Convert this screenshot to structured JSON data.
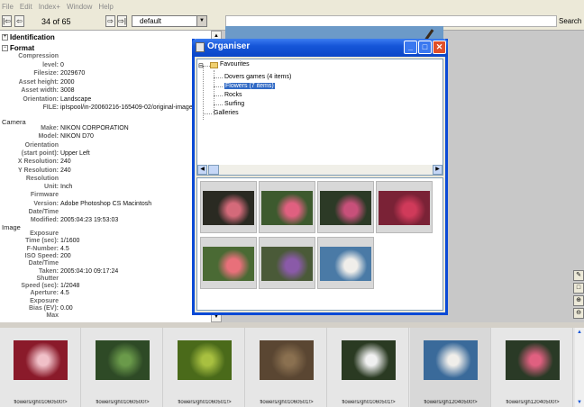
{
  "menu": [
    "File",
    "Edit",
    "Index+",
    "Window",
    "Help"
  ],
  "toolbar": {
    "first_icon": "first-icon",
    "prev_icon": "prev-icon",
    "counter": "34 of 65",
    "next_icon": "next-icon",
    "last_icon": "last-icon",
    "profile": "default",
    "search_label": "Search"
  },
  "info": {
    "identification_title": "Identification",
    "format_title": "Format",
    "format_rows": [
      {
        "label": "Compression",
        "value": ""
      },
      {
        "label": "level:",
        "value": "0"
      },
      {
        "label": "Filesize:",
        "value": "2029670"
      },
      {
        "label": "Asset height:",
        "value": "2000"
      },
      {
        "label": "Asset width:",
        "value": "3008"
      },
      {
        "label": "Orientation:",
        "value": "Landscape"
      },
      {
        "label": "FILE:",
        "value": "ipIspool/in-20060216-165409-02/original-image"
      }
    ],
    "camera_title": "Camera",
    "camera_rows": [
      {
        "label": "Make:",
        "value": "NIKON CORPORATION"
      },
      {
        "label": "Model:",
        "value": "NIKON D70"
      },
      {
        "label": "Orientation",
        "value": ""
      },
      {
        "label": "(start point):",
        "value": "Upper Left"
      },
      {
        "label": "X Resolution:",
        "value": "240"
      },
      {
        "label": "Y Resolution:",
        "value": "240"
      },
      {
        "label": "Resolution",
        "value": ""
      },
      {
        "label": "Unit:",
        "value": "Inch"
      },
      {
        "label": "Firmware",
        "value": ""
      },
      {
        "label": "Version:",
        "value": "Adobe Photoshop CS Macintosh"
      },
      {
        "label": "Date/Time",
        "value": ""
      },
      {
        "label": "Modified:",
        "value": "2005:04:23 19:53:03"
      }
    ],
    "image_title": "Image",
    "image_rows": [
      {
        "label": "Exposure",
        "value": ""
      },
      {
        "label": "Time (sec):",
        "value": "1/1600"
      },
      {
        "label": "F-Number:",
        "value": "4.5"
      },
      {
        "label": "ISO Speed:",
        "value": "200"
      },
      {
        "label": "Date/Time",
        "value": ""
      },
      {
        "label": "Taken:",
        "value": "2005:04:10 09:17:24"
      },
      {
        "label": "Shutter",
        "value": ""
      },
      {
        "label": "Speed (sec):",
        "value": "1/2048"
      },
      {
        "label": "Aperture:",
        "value": "4.5"
      },
      {
        "label": "Exposure",
        "value": ""
      },
      {
        "label": "Bias (EV):",
        "value": "0.00"
      },
      {
        "label": "Max",
        "value": ""
      }
    ]
  },
  "organiser": {
    "title": "Organiser",
    "tree": {
      "root": "Favourites",
      "children": [
        "Dovers games (4 items)",
        "Flowers (7 items)",
        "Rocks",
        "Surfing"
      ],
      "selected": "Flowers (7 items)",
      "galleries": "Galleries"
    },
    "thumbs": [
      {
        "name": "pink-roses-dark-1",
        "bg": "#2a2a22",
        "accent": "#d46a7a"
      },
      {
        "name": "pink-rose-green",
        "bg": "#3d5a2e",
        "accent": "#e06080"
      },
      {
        "name": "rose-leaves",
        "bg": "#2c3a26",
        "accent": "#c8507a"
      },
      {
        "name": "magenta-flower",
        "bg": "#7a2236",
        "accent": "#d03a5a"
      },
      {
        "name": "pink-rose-bud",
        "bg": "#4a6a34",
        "accent": "#e8707a"
      },
      {
        "name": "purple-flowers",
        "bg": "#4a5a38",
        "accent": "#8a5aa8"
      },
      {
        "name": "white-blossom-sky",
        "bg": "#4a7aa6",
        "accent": "#f0eeea"
      }
    ]
  },
  "side_tools": [
    "edit-icon",
    "window-icon",
    "zoom-in-icon",
    "zoom-out-icon"
  ],
  "strip": [
    {
      "caption": "flowers/gh01060500!>",
      "bg": "#8a1a2a",
      "accent": "#f0c0c8"
    },
    {
      "caption": "flowers/gh01060500!>",
      "bg": "#2e4a26",
      "accent": "#6a9a4a"
    },
    {
      "caption": "flowers/gh01060501!>",
      "bg": "#4a6a1a",
      "accent": "#a8c040"
    },
    {
      "caption": "flowers/gh01060501!>",
      "bg": "#5a4632",
      "accent": "#8a7050"
    },
    {
      "caption": "flowers/gh01060501!>",
      "bg": "#2a3a22",
      "accent": "#f0f0f0"
    },
    {
      "caption": "flowers/gh12040500!>",
      "bg": "#3a6a9a",
      "accent": "#f0eeea"
    },
    {
      "caption": "flowers/gh12040500!>",
      "bg": "#2a3a26",
      "accent": "#e06080"
    }
  ]
}
